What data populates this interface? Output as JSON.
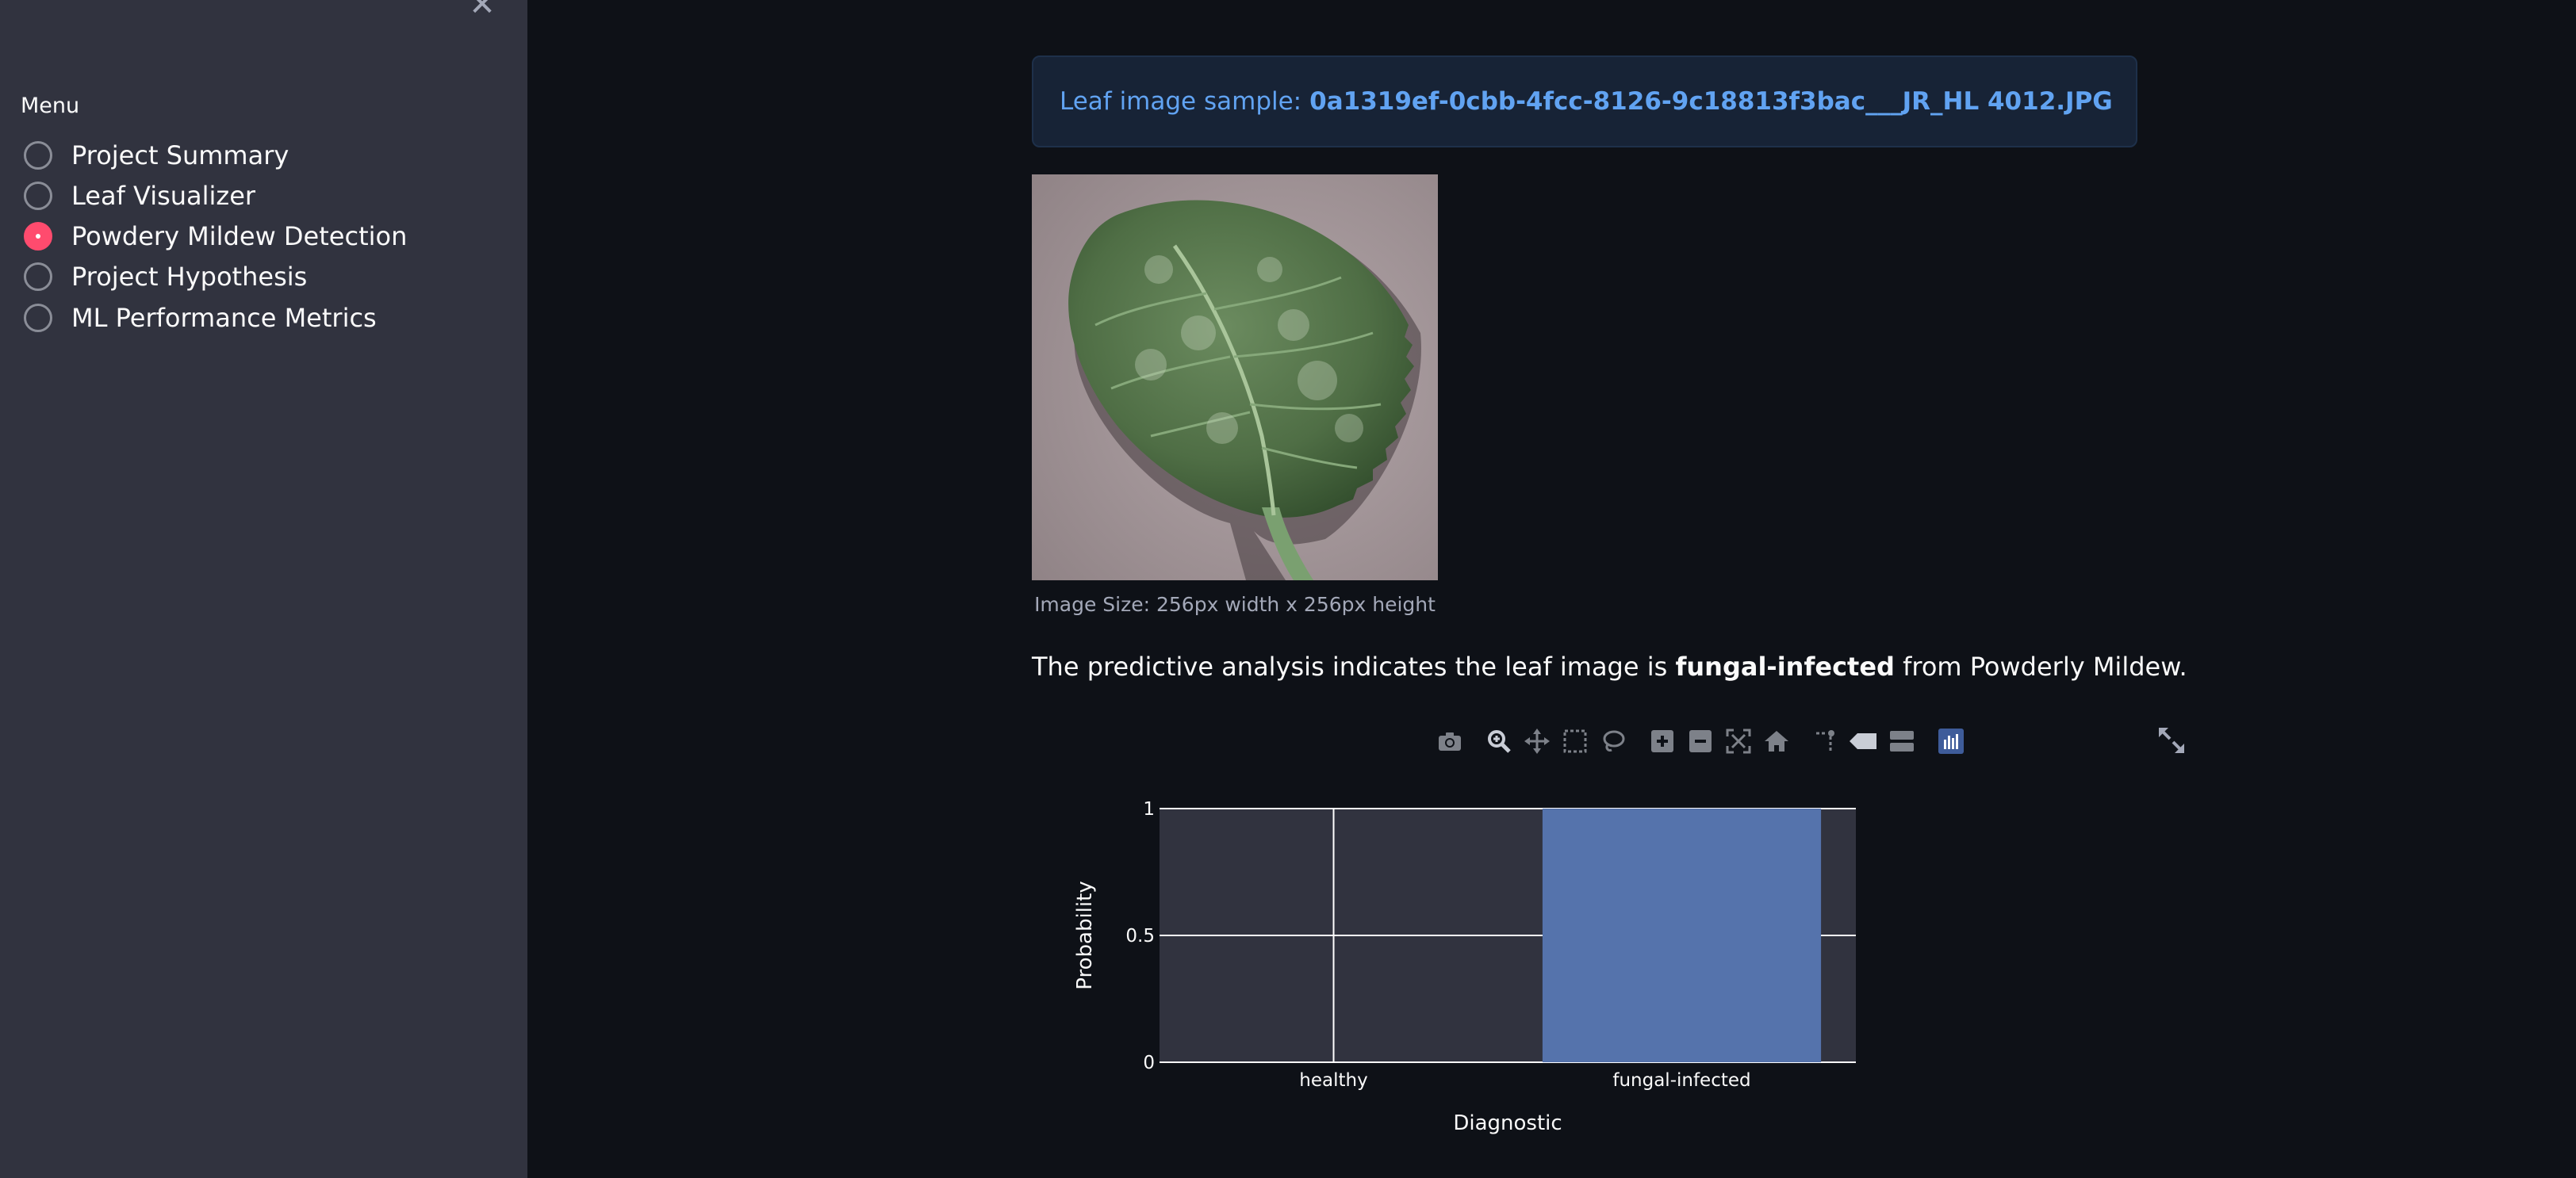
{
  "sidebar": {
    "close_glyph": "✕",
    "menu_label": "Menu",
    "items": [
      {
        "label": "Project Summary",
        "selected": false
      },
      {
        "label": "Leaf Visualizer",
        "selected": false
      },
      {
        "label": "Powdery Mildew Detection",
        "selected": true
      },
      {
        "label": "Project Hypothesis",
        "selected": false
      },
      {
        "label": "ML Performance Metrics",
        "selected": false
      }
    ]
  },
  "main": {
    "info_prefix": "Leaf image sample:",
    "info_filename": "0a1319ef-0cbb-4fcc-8126-9c18813f3bac___JR_HL 4012.JPG",
    "image_caption": "Image Size: 256px width x 256px height",
    "prediction_before": "The predictive analysis indicates the leaf image is",
    "prediction_result": "fungal-infected",
    "prediction_after": "from Powderly Mildew."
  },
  "toolbar": {
    "icons": [
      "camera-icon",
      "zoom-icon",
      "pan-icon",
      "box-select-icon",
      "lasso-select-icon",
      "zoom-in-icon",
      "zoom-out-icon",
      "autoscale-icon",
      "reset-axes-icon",
      "spike-lines-icon",
      "hover-closest-icon",
      "hover-compare-icon",
      "plotly-logo-icon"
    ]
  },
  "colors": {
    "accent": "#ff4b6e",
    "bar": "#5573ac",
    "plot_bg": "#31333f",
    "info_text": "#61a3f2"
  },
  "chart_data": {
    "type": "bar",
    "categories": [
      "healthy",
      "fungal-infected"
    ],
    "values": [
      0,
      1
    ],
    "xlabel": "Diagnostic",
    "ylabel": "Probability",
    "ylim": [
      0,
      1
    ],
    "yticks": [
      0,
      0.5,
      1
    ],
    "ytick_labels": [
      "0",
      "0.5",
      "1"
    ],
    "grid": true
  }
}
